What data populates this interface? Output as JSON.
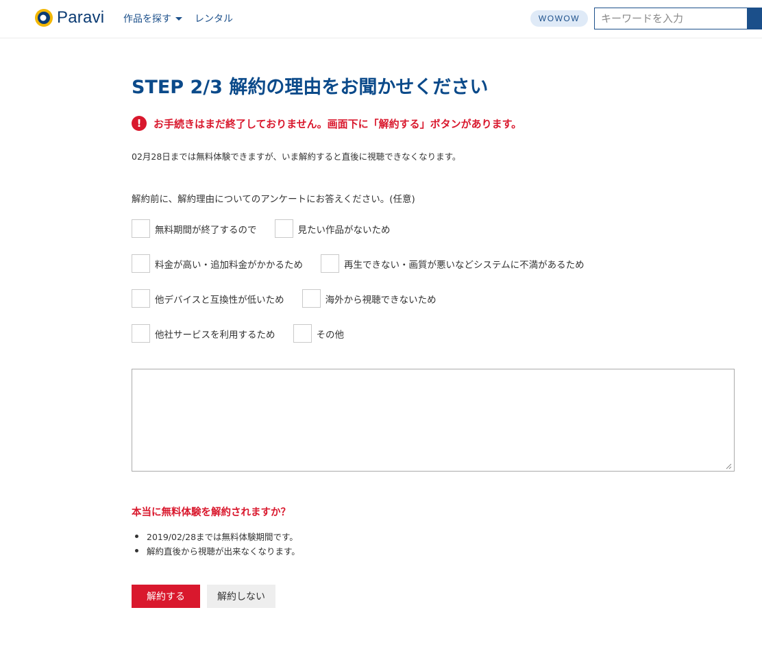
{
  "header": {
    "logo_text": "Paravi",
    "nav": [
      {
        "label": "作品を探す"
      },
      {
        "label": "レンタル"
      }
    ],
    "wowow_label": "WOWOW",
    "search_placeholder": "キーワードを入力"
  },
  "main": {
    "title": "STEP 2/3 解約の理由をお聞かせください",
    "alert": "お手続きはまだ終了しておりません。画面下に「解約する」ボタンがあります。",
    "trial_note": "02月28日までは無料体験できますが、いま解約すると直後に視聴できなくなります。",
    "survey_intro": "解約前に、解約理由についてのアンケートにお答えください。(任意)",
    "reasons": [
      [
        "無料期間が終了するので",
        "見たい作品がないため"
      ],
      [
        "料金が高い・追加料金がかかるため",
        "再生できない・画質が悪いなどシステムに不満があるため"
      ],
      [
        "他デバイスと互換性が低いため",
        "海外から視聴できないため"
      ],
      [
        "他社サービスを利用するため",
        "その他"
      ]
    ],
    "confirm_question": "本当に無料体験を解約されますか？",
    "bullets": [
      "2019/02/28までは無料体験期間です。",
      "解約直後から視聴が出来なくなります。"
    ],
    "cancel_button": "解約する",
    "keep_button": "解約しない"
  },
  "colors": {
    "brand_blue": "#0b4a8a",
    "alert_red": "#d9182d"
  }
}
